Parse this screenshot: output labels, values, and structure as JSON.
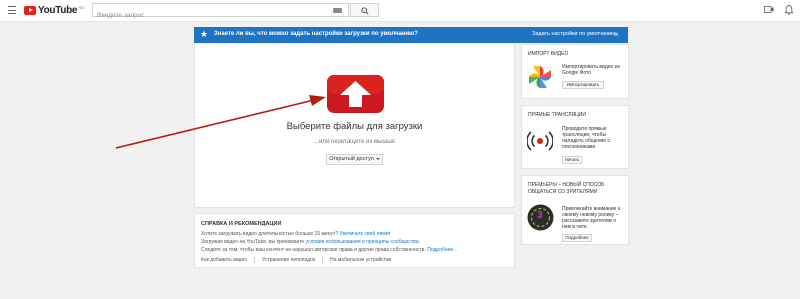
{
  "masthead": {
    "logo_text": "YouTube",
    "logo_sup": "RU",
    "search_placeholder": "Введите запрос",
    "icons": [
      "menu-icon",
      "keyboard-icon",
      "search-icon",
      "upload-video-icon",
      "apps-icon",
      "notifications-icon"
    ]
  },
  "notice": {
    "text": "Знаете ли вы, что можно задать настройки загрузки по умолчанию?",
    "link": "Задать настройки по умолчанию",
    "close": "×"
  },
  "upload": {
    "title": "Выберите файлы для загрузки",
    "subtitle": "...или перетащите их мышью",
    "access_button": "Открытый доступ"
  },
  "help": {
    "title": "СПРАВКА И РЕКОМЕНДАЦИИ",
    "line1_text": "Хотите загружать видео длительностью больше 15 минут?",
    "line1_link": "Увеличьте свой лимит",
    "line2_text": "Загружая видео на YouTube, вы принимаете",
    "line2_link": "условия использования и принципы сообщества.",
    "line3_text": "Следите за тем, чтобы ваш контент не нарушал авторские права и другие права собственности.",
    "line3_link": "Подробнее...",
    "links": [
      "Как добавить видео",
      "Устранение неполадок",
      "На мобильном устройстве"
    ]
  },
  "import_card": {
    "title": "ИМПОРТ ВИДЕО",
    "text": "Импортировать видео из Google Фото",
    "button": "Импортировать"
  },
  "live_card": {
    "title": "ПРЯМЫЕ ТРАНСЛЯЦИИ",
    "text": "Проводите прямые трансляции, чтобы наладить общение с поклонниками",
    "button": "Начать"
  },
  "premiere_card": {
    "title": "ПРЕМЬЕРЫ – НОВЫЙ СПОСОБ ОБЩАТЬСЯ СО ЗРИТЕЛЯМИ",
    "text": "Привлекайте внимание к своему новому ролику – расскажите зрителям о нем в чате.",
    "button": "Подробнее",
    "badge": "3"
  },
  "colors": {
    "accent_blue": "#1e73c2",
    "youtube_red": "#e62117",
    "annotation_arrow": "#b01e14",
    "link_blue": "#167ac6"
  }
}
